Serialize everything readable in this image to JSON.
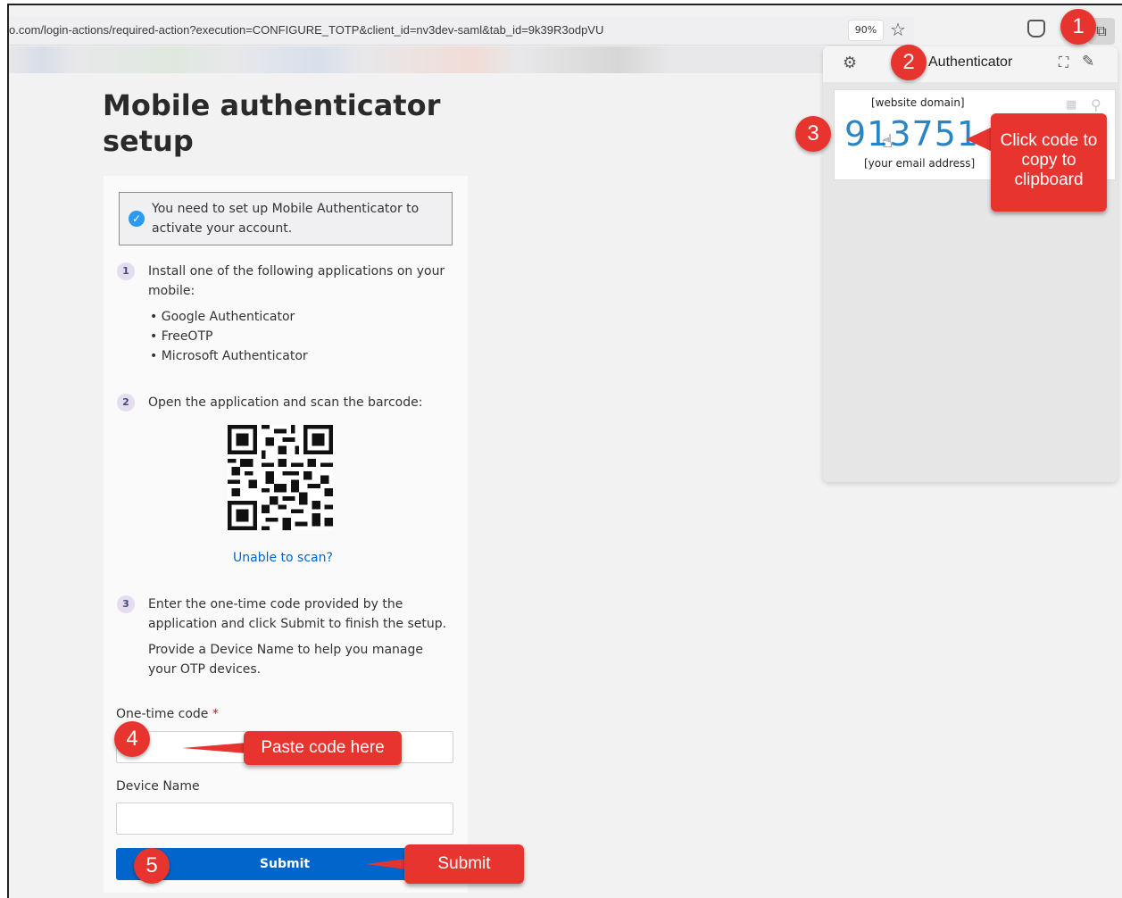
{
  "browser": {
    "url": "o.com/login-actions/required-action?execution=CONFIGURE_TOTP&client_id=nv3dev-saml&tab_id=9k39R3odpVU",
    "zoom": "90%"
  },
  "page": {
    "title": "Mobile authenticator setup",
    "alert": "You need to set up Mobile Authenticator to activate your account.",
    "step1_num": "1",
    "step1_text": "Install one of the following applications on your mobile:",
    "apps": [
      "Google Authenticator",
      "FreeOTP",
      "Microsoft Authenticator"
    ],
    "step2_num": "2",
    "step2_text": "Open the application and scan the barcode:",
    "unable_link": "Unable to scan?",
    "step3_num": "3",
    "step3_text": "Enter the one-time code provided by the application and click Submit to finish the setup.",
    "step3_extra": "Provide a Device Name to help you manage your OTP devices.",
    "otp_label": "One-time code",
    "otp_required": "*",
    "device_label": "Device Name",
    "submit_label": "Submit"
  },
  "extension": {
    "title": "Authenticator",
    "domain": "[website domain]",
    "code": "913751",
    "email": "[your email address]"
  },
  "annotations": {
    "m1": "1",
    "m2": "2",
    "m3": "3",
    "m4": "4",
    "m5": "5",
    "copy_callout": "Click code to copy to clipboard",
    "paste_callout": "Paste code here",
    "submit_callout": "Submit"
  },
  "colors": {
    "annotation_red": "#e8342e",
    "primary_blue": "#0066cc",
    "code_blue": "#2a85c5"
  }
}
